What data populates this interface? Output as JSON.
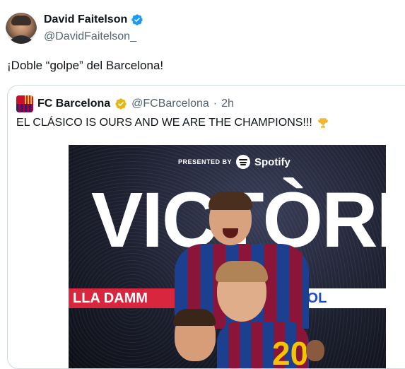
{
  "author": {
    "name": "David Faitelson",
    "handle": "@DavidFaitelson_",
    "avatar_icon": "profile-photo",
    "verified_icon": "verified-badge-blue",
    "verified_color": "#1d9bf0"
  },
  "tweet": {
    "text": "¡Doble “golpe” del Barcelona!"
  },
  "quote": {
    "name": "FC Barcelona",
    "handle": "@FCBarcelona",
    "separator": "·",
    "time": "2h",
    "avatar_icon": "fc-barcelona-crest",
    "badge_icon": "verified-badge-gold",
    "badge_color": "#e2b719",
    "text": "EL CLÁSICO IS OURS AND WE ARE THE CHAMPIONS!!!",
    "emoji_icon": "trophy-icon"
  },
  "media": {
    "presented_by": "PRESENTED BY",
    "sponsor": "Spotify",
    "headline": "VICTÒRIA",
    "board_left": "LLA DAMM",
    "board_right": "OOL",
    "shirt_number": "20"
  }
}
